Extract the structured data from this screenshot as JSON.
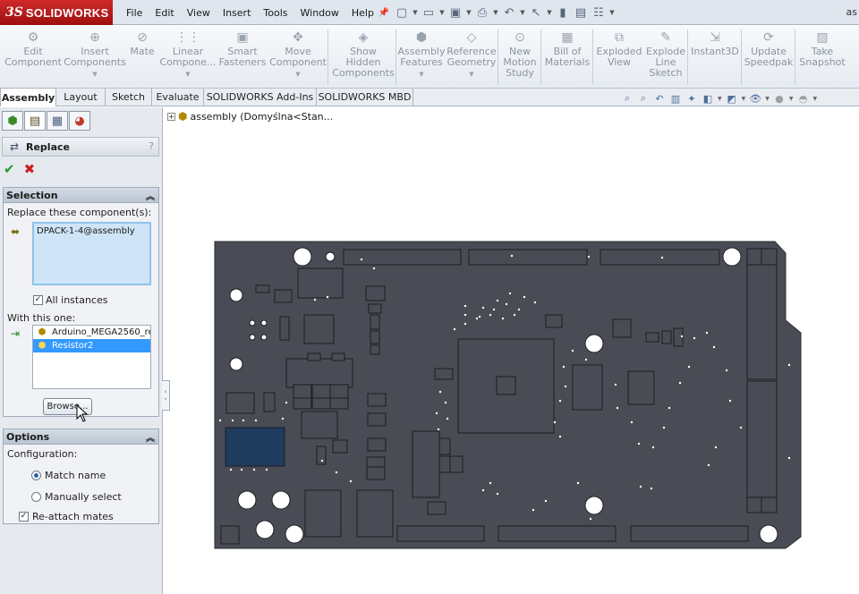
{
  "app": {
    "logo_mark": "3S",
    "brand": "SOLIDWORKS",
    "title_fragment": "as"
  },
  "menus": [
    "File",
    "Edit",
    "View",
    "Insert",
    "Tools",
    "Window",
    "Help"
  ],
  "quick_access_icons": [
    "pin-icon",
    "new-document-icon",
    "open-icon",
    "save-icon",
    "print-icon",
    "undo-icon",
    "select-icon",
    "rebuild-icon",
    "file-properties-icon",
    "options-icon"
  ],
  "ribbon": {
    "buttons": [
      {
        "label": "Edit\nComponent",
        "icon": "edit-component-icon"
      },
      {
        "label": "Insert\nComponents",
        "icon": "insert-components-icon"
      },
      {
        "label": "Mate",
        "icon": "mate-icon"
      },
      {
        "label": "Linear\nCompone...",
        "icon": "linear-pattern-icon"
      },
      {
        "label": "Smart\nFasteners",
        "icon": "smart-fasteners-icon"
      },
      {
        "label": "Move\nComponent",
        "icon": "move-component-icon"
      },
      {
        "label": "Show\nHidden\nComponents",
        "icon": "show-hidden-icon"
      },
      {
        "label": "Assembly\nFeatures",
        "icon": "assembly-features-icon"
      },
      {
        "label": "Reference\nGeometry",
        "icon": "reference-geometry-icon"
      },
      {
        "label": "New\nMotion\nStudy",
        "icon": "motion-study-icon"
      },
      {
        "label": "Bill of\nMaterials",
        "icon": "bom-icon"
      },
      {
        "label": "Exploded\nView",
        "icon": "exploded-view-icon"
      },
      {
        "label": "Explode\nLine\nSketch",
        "icon": "explode-line-icon"
      },
      {
        "label": "Instant3D",
        "icon": "instant3d-icon"
      },
      {
        "label": "Update\nSpeedpak",
        "icon": "speedpak-icon"
      },
      {
        "label": "Take\nSnapshot",
        "icon": "snapshot-icon"
      }
    ]
  },
  "tabs": [
    "Assembly",
    "Layout",
    "Sketch",
    "Evaluate",
    "SOLIDWORKS Add-Ins",
    "SOLIDWORKS MBD"
  ],
  "active_tab": "Assembly",
  "property_manager": {
    "title": "Replace",
    "help": "?",
    "selection": {
      "heading": "Selection",
      "replace_label": "Replace these component(s):",
      "replace_items": [
        "DPACK-1-4@assembly"
      ],
      "all_instances_label": "All instances",
      "all_instances_checked": true,
      "with_label": "With this one:",
      "with_items": [
        "Arduino_MEGA2560_re",
        "Resistor2"
      ],
      "with_selected_index": 1,
      "browse_label": "Browse..."
    },
    "options": {
      "heading": "Options",
      "configuration_label": "Configuration:",
      "radio_options": [
        "Match name",
        "Manually select"
      ],
      "radio_selected_index": 0,
      "reattach_label": "Re-attach mates",
      "reattach_checked": true
    }
  },
  "feature_tree": {
    "root_label": "assembly  (Domyślna<Stan..."
  },
  "colors": {
    "board": "#4a4c55",
    "board_outline": "#2b2c33",
    "highlight_component": "#1f3b5e",
    "accent_selection": "#3399ff"
  }
}
